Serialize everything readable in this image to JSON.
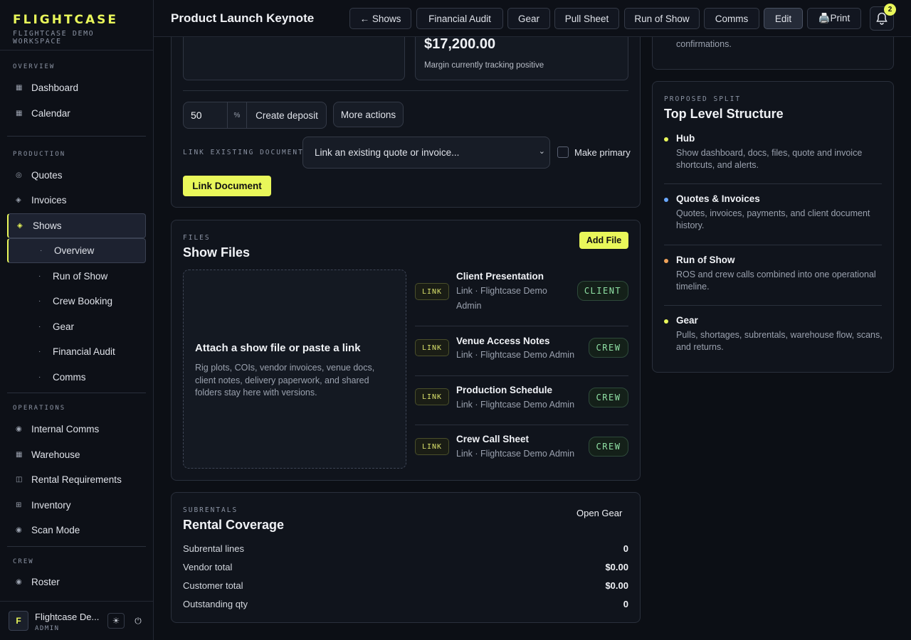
{
  "brand": {
    "logo": "FLIGHTCASE",
    "subtitle": "FLIGHTCASE DEMO WORKSPACE"
  },
  "sidebar": {
    "sections": [
      {
        "label": "OVERVIEW"
      },
      {
        "label": "PRODUCTION"
      },
      {
        "label": "OPERATIONS"
      },
      {
        "label": "CREW"
      }
    ],
    "items": {
      "dashboard": "Dashboard",
      "calendar": "Calendar",
      "quotes": "Quotes",
      "invoices": "Invoices",
      "shows": "Shows",
      "overview": "Overview",
      "run_of_show": "Run of Show",
      "crew_booking": "Crew Booking",
      "gear": "Gear",
      "financial_audit": "Financial Audit",
      "comms": "Comms",
      "internal_comms": "Internal Comms",
      "warehouse": "Warehouse",
      "rental_requirements": "Rental Requirements",
      "inventory": "Inventory",
      "scan_mode": "Scan Mode",
      "roster": "Roster"
    },
    "user": {
      "initial": "F",
      "name": "Flightcase De...",
      "role": "ADMIN"
    }
  },
  "header": {
    "title": "Product Launch Keynote",
    "buttons": {
      "back": "← Shows",
      "financial_audit": "Financial Audit",
      "gear": "Gear",
      "pull_sheet": "Pull Sheet",
      "run_of_show": "Run of Show",
      "comms": "Comms",
      "edit": "Edit",
      "print": "🖨️Print"
    },
    "notification_count": "2"
  },
  "documents": {
    "margin_amount": "$17,200.00",
    "margin_note": "Margin currently tracking positive",
    "deposit_percent": "50",
    "percent_symbol": "%",
    "create_deposit": "Create deposit",
    "more_actions": "More actions",
    "link_existing_label": "LINK EXISTING DOCUMENT",
    "link_select_placeholder": "Link an existing quote or invoice...",
    "make_primary": "Make primary",
    "link_document": "Link Document"
  },
  "files": {
    "eyebrow": "FILES",
    "title": "Show Files",
    "add_file": "Add File",
    "dropzone_title": "Attach a show file or paste a link",
    "dropzone_desc": "Rig plots, COIs, vendor invoices, venue docs, client notes, delivery paperwork, and shared folders stay here with versions.",
    "items": [
      {
        "tag": "LINK",
        "title": "Client Presentation",
        "meta": "Link · Flightcase Demo Admin",
        "role": "CLIENT"
      },
      {
        "tag": "LINK",
        "title": "Venue Access Notes",
        "meta": "Link · Flightcase Demo Admin",
        "role": "CREW"
      },
      {
        "tag": "LINK",
        "title": "Production Schedule",
        "meta": "Link · Flightcase Demo Admin",
        "role": "CREW"
      },
      {
        "tag": "LINK",
        "title": "Crew Call Sheet",
        "meta": "Link · Flightcase Demo Admin",
        "role": "CREW"
      }
    ]
  },
  "subrentals": {
    "eyebrow": "SUBRENTALS",
    "title": "Rental Coverage",
    "open_gear": "Open Gear",
    "rows": [
      {
        "label": "Subrental lines",
        "value": "0"
      },
      {
        "label": "Vendor total",
        "value": "$0.00"
      },
      {
        "label": "Customer total",
        "value": "$0.00"
      },
      {
        "label": "Outstanding qty",
        "value": "0"
      }
    ]
  },
  "right_panel": {
    "top_card_text": "confirmations.",
    "eyebrow": "PROPOSED SPLIT",
    "title": "Top Level Structure",
    "items": [
      {
        "title": "Hub",
        "desc": "Show dashboard, docs, files, quote and invoice shortcuts, and alerts.",
        "color": "#e9f75a"
      },
      {
        "title": "Quotes & Invoices",
        "desc": "Quotes, invoices, payments, and client document history.",
        "color": "#6aa8ff"
      },
      {
        "title": "Run of Show",
        "desc": "ROS and crew calls combined into one operational timeline.",
        "color": "#f0a35a"
      },
      {
        "title": "Gear",
        "desc": "Pulls, shortages, subrentals, warehouse flow, scans, and returns.",
        "color": "#e9f75a"
      }
    ]
  }
}
